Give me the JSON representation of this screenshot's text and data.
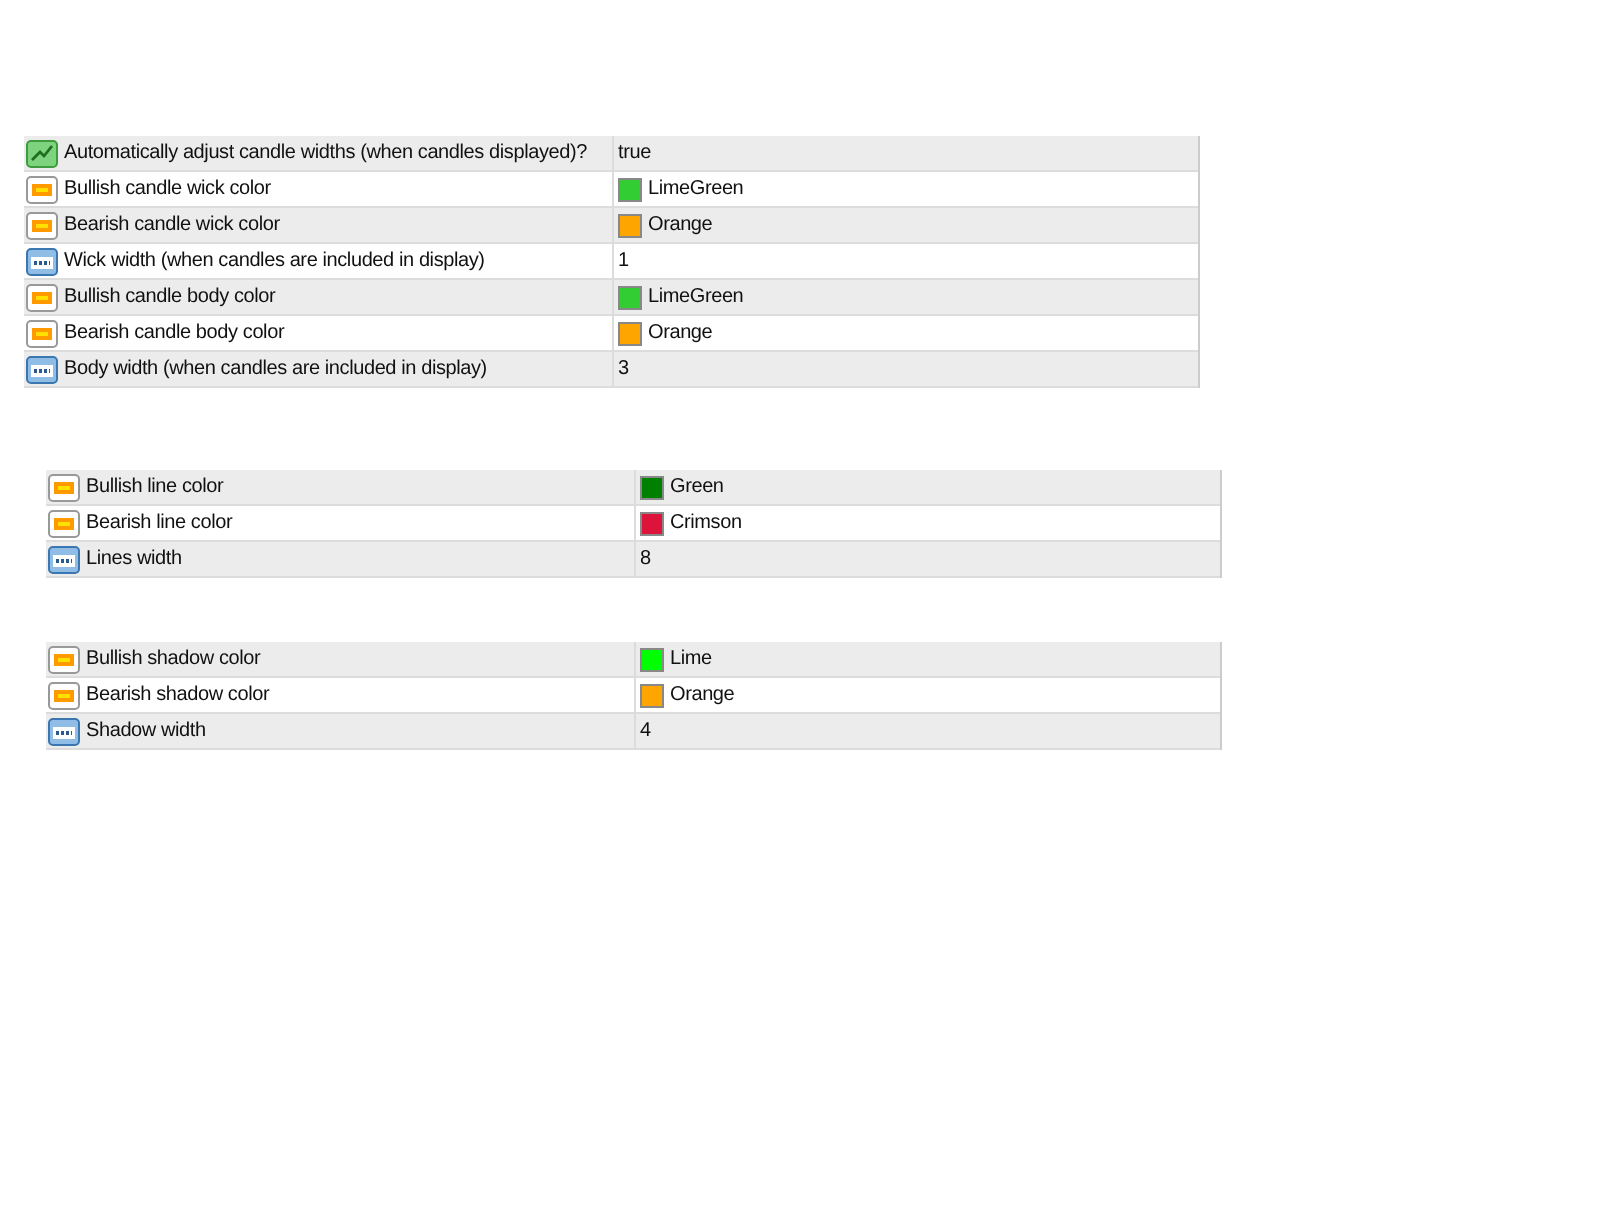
{
  "panels": [
    {
      "rows": [
        {
          "kind": "bool",
          "name": "Automatically adjust candle widths (when candles displayed)?",
          "value": "true"
        },
        {
          "kind": "color",
          "name": "Bullish candle wick color",
          "value": "LimeGreen",
          "color": "#32cd32"
        },
        {
          "kind": "color",
          "name": "Bearish candle wick color",
          "value": "Orange",
          "color": "#ffa500"
        },
        {
          "kind": "number",
          "name": "Wick width (when candles are included in display)",
          "value": "1"
        },
        {
          "kind": "color",
          "name": "Bullish candle body color",
          "value": "LimeGreen",
          "color": "#32cd32"
        },
        {
          "kind": "color",
          "name": "Bearish candle body color",
          "value": "Orange",
          "color": "#ffa500"
        },
        {
          "kind": "number",
          "name": "Body width (when candles are included in display)",
          "value": "3"
        }
      ]
    },
    {
      "rows": [
        {
          "kind": "color",
          "name": "Bullish line color",
          "value": "Green",
          "color": "#008000"
        },
        {
          "kind": "color",
          "name": "Bearish line color",
          "value": "Crimson",
          "color": "#dc143c"
        },
        {
          "kind": "number",
          "name": "Lines width",
          "value": "8"
        }
      ]
    },
    {
      "rows": [
        {
          "kind": "color",
          "name": "Bullish shadow color",
          "value": "Lime",
          "color": "#00ff00"
        },
        {
          "kind": "color",
          "name": "Bearish shadow color",
          "value": "Orange",
          "color": "#ffa500"
        },
        {
          "kind": "number",
          "name": "Shadow width",
          "value": "4"
        }
      ]
    }
  ]
}
